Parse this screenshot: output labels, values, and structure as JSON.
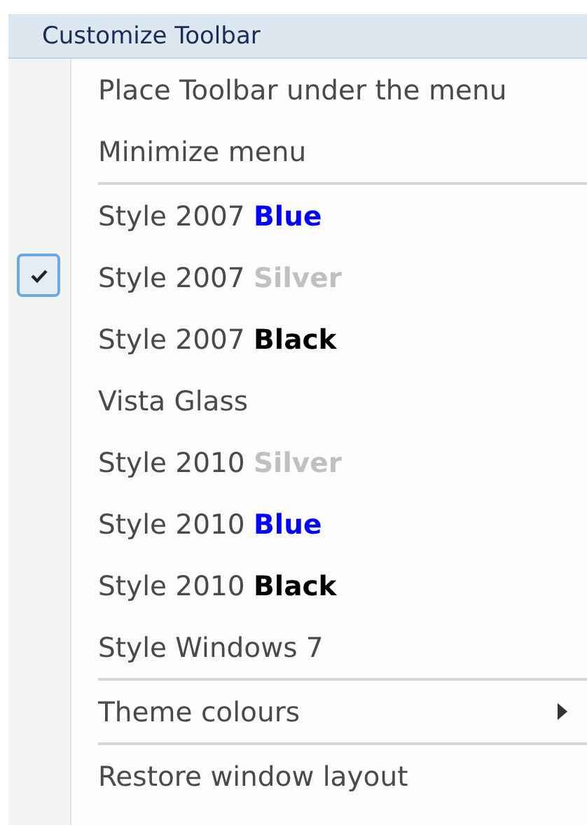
{
  "menu": {
    "title": "Customize Toolbar",
    "items": [
      {
        "kind": "item",
        "label": "Place Toolbar under the menu",
        "checked": false,
        "submenu": false
      },
      {
        "kind": "item",
        "label": "Minimize menu",
        "checked": false,
        "submenu": false
      },
      {
        "kind": "separator"
      },
      {
        "kind": "item",
        "label": "Style 2007",
        "accent": "Blue",
        "color": "#0000ff",
        "checked": false,
        "submenu": false
      },
      {
        "kind": "item",
        "label": "Style 2007",
        "accent": "Silver",
        "color": "#c0c0c0",
        "checked": true,
        "submenu": false
      },
      {
        "kind": "item",
        "label": "Style 2007",
        "accent": "Black",
        "color": "#000000",
        "checked": false,
        "submenu": false
      },
      {
        "kind": "item",
        "label": "Vista Glass",
        "checked": false,
        "submenu": false
      },
      {
        "kind": "item",
        "label": "Style 2010",
        "accent": "Silver",
        "color": "#c0c0c0",
        "checked": false,
        "submenu": false
      },
      {
        "kind": "item",
        "label": "Style 2010",
        "accent": "Blue",
        "color": "#0000ff",
        "checked": false,
        "submenu": false
      },
      {
        "kind": "item",
        "label": "Style 2010",
        "accent": "Black",
        "color": "#000000",
        "checked": false,
        "submenu": false
      },
      {
        "kind": "item",
        "label": "Style Windows 7",
        "checked": false,
        "submenu": false
      },
      {
        "kind": "separator"
      },
      {
        "kind": "item",
        "label": "Theme colours",
        "checked": false,
        "submenu": true
      },
      {
        "kind": "separator"
      },
      {
        "kind": "item",
        "label": "Restore window layout",
        "checked": false,
        "submenu": false
      }
    ]
  }
}
